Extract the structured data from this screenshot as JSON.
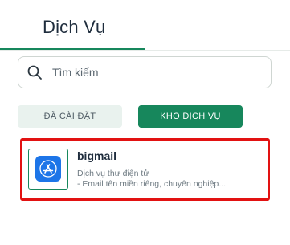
{
  "header": {
    "title": "Dịch Vụ"
  },
  "search": {
    "placeholder": "Tìm kiếm",
    "value": ""
  },
  "tabs": [
    {
      "label": "ĐÃ CÀI ĐẶT",
      "active": false
    },
    {
      "label": "KHO DỊCH VỤ",
      "active": true
    }
  ],
  "apps": [
    {
      "name": "bigmail",
      "description_line1": "Dịch vụ thư điện tử",
      "description_line2": "- Email tên miền riêng, chuyên nghiệp....",
      "icon": "app-store-icon",
      "icon_color": "#1d75e8",
      "highlight_color": "#e21212"
    }
  ],
  "colors": {
    "accent": "#17875c"
  }
}
